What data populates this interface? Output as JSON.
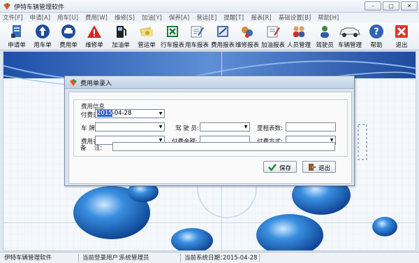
{
  "window": {
    "title": "伊特车辆管理软件",
    "controls": [
      "–",
      "□",
      "✕"
    ]
  },
  "menu": [
    {
      "label": "文件",
      "key": "[F]"
    },
    {
      "label": "申请",
      "key": "[A]"
    },
    {
      "label": "用车",
      "key": "[U]"
    },
    {
      "label": "费用",
      "key": "[W]"
    },
    {
      "label": "维修",
      "key": "[S]"
    },
    {
      "label": "加油",
      "key": "[Y]"
    },
    {
      "label": "保养",
      "key": "[A]"
    },
    {
      "label": "营运",
      "key": "[E]"
    },
    {
      "label": "提醒",
      "key": "[T]"
    },
    {
      "label": "报表",
      "key": "[R]"
    },
    {
      "label": "基础设置",
      "key": "[B]"
    },
    {
      "label": "帮助",
      "key": "[H]"
    }
  ],
  "toolbar": [
    {
      "label": "申请单",
      "icon": "application-form-icon"
    },
    {
      "label": "用车单",
      "icon": "up-arrow-icon"
    },
    {
      "label": "费用单",
      "icon": "car-badge-icon"
    },
    {
      "label": "维修单",
      "icon": "warning-triangle-icon"
    },
    {
      "label": "加油单",
      "icon": "fuel-pump-icon"
    },
    {
      "label": "营运单",
      "icon": "money-icon"
    },
    {
      "label": "行车报表",
      "icon": "spreadsheet-icon"
    },
    {
      "label": "用车报表",
      "icon": "edit-report-icon"
    },
    {
      "label": "费用报表",
      "icon": "chart-report-icon"
    },
    {
      "label": "维修报表",
      "icon": "tools-report-icon"
    },
    {
      "label": "加油报表",
      "icon": "fuel-report-icon"
    },
    {
      "label": "人员管理",
      "icon": "people-icon"
    },
    {
      "label": "驾驶员",
      "icon": "driver-icon"
    },
    {
      "label": "车辆管理",
      "icon": "car-icon"
    },
    {
      "label": "帮助",
      "icon": "help-icon"
    },
    {
      "label": "退出",
      "icon": "exit-icon"
    }
  ],
  "dialog": {
    "title": "费用单录入",
    "group_title": "费用信息",
    "fields": {
      "pay_date": {
        "label": "付费日期:",
        "value_selected": "2015",
        "value_rest": "-04-28"
      },
      "plate": {
        "label": "车 牌 号:",
        "value": ""
      },
      "driver": {
        "label": "驾 驶 员:",
        "value": ""
      },
      "mileage": {
        "label": "里程表数:",
        "value": ""
      },
      "fee_name": {
        "label": "费用名称:",
        "value": ""
      },
      "amount": {
        "label": "付费金额:",
        "value": ""
      },
      "pay_method": {
        "label": "付费方式:",
        "value": ""
      },
      "remark": {
        "label": "备　 注:",
        "value": ""
      }
    },
    "save_label": "保存",
    "exit_label": "退出"
  },
  "status": {
    "app": "伊特车辆管理软件",
    "user_label": "当前登录用户：",
    "user_value": "系统管理员",
    "date_label": "当前系统日期：",
    "date_value": "2015-04-28"
  }
}
